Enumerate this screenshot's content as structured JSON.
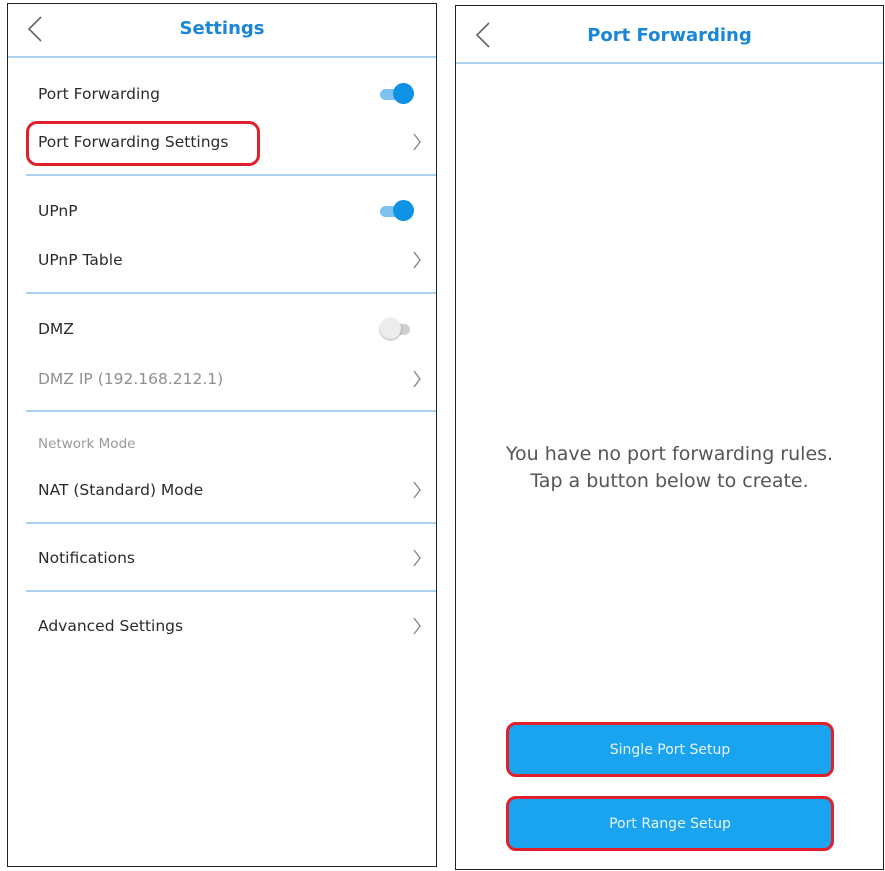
{
  "settings": {
    "title": "Settings",
    "items": {
      "port_forwarding": "Port Forwarding",
      "port_forwarding_settings": "Port Forwarding Settings",
      "upnp": "UPnP",
      "upnp_table": "UPnP Table",
      "dmz": "DMZ",
      "dmz_ip": "DMZ IP (192.168.212.1)",
      "network_mode_header": "Network Mode",
      "nat_mode": "NAT (Standard) Mode",
      "notifications": "Notifications",
      "advanced_settings": "Advanced Settings"
    },
    "toggles": {
      "port_forwarding": true,
      "upnp": true,
      "dmz": false
    }
  },
  "port_forwarding": {
    "title": "Port Forwarding",
    "empty_line1": "You have no port forwarding rules.",
    "empty_line2": "Tap a button below to create.",
    "single_port_button": "Single Port Setup",
    "port_range_button": "Port Range Setup"
  },
  "colors": {
    "accent": "#1a86d6",
    "toggle_on": "#0f92e4",
    "button_bg": "#1aa3ef",
    "highlight": "#e0202a",
    "divider": "#a9d3ef"
  },
  "icons": {
    "back": "chevron-left-icon",
    "row_arrow": "chevron-right-icon"
  }
}
